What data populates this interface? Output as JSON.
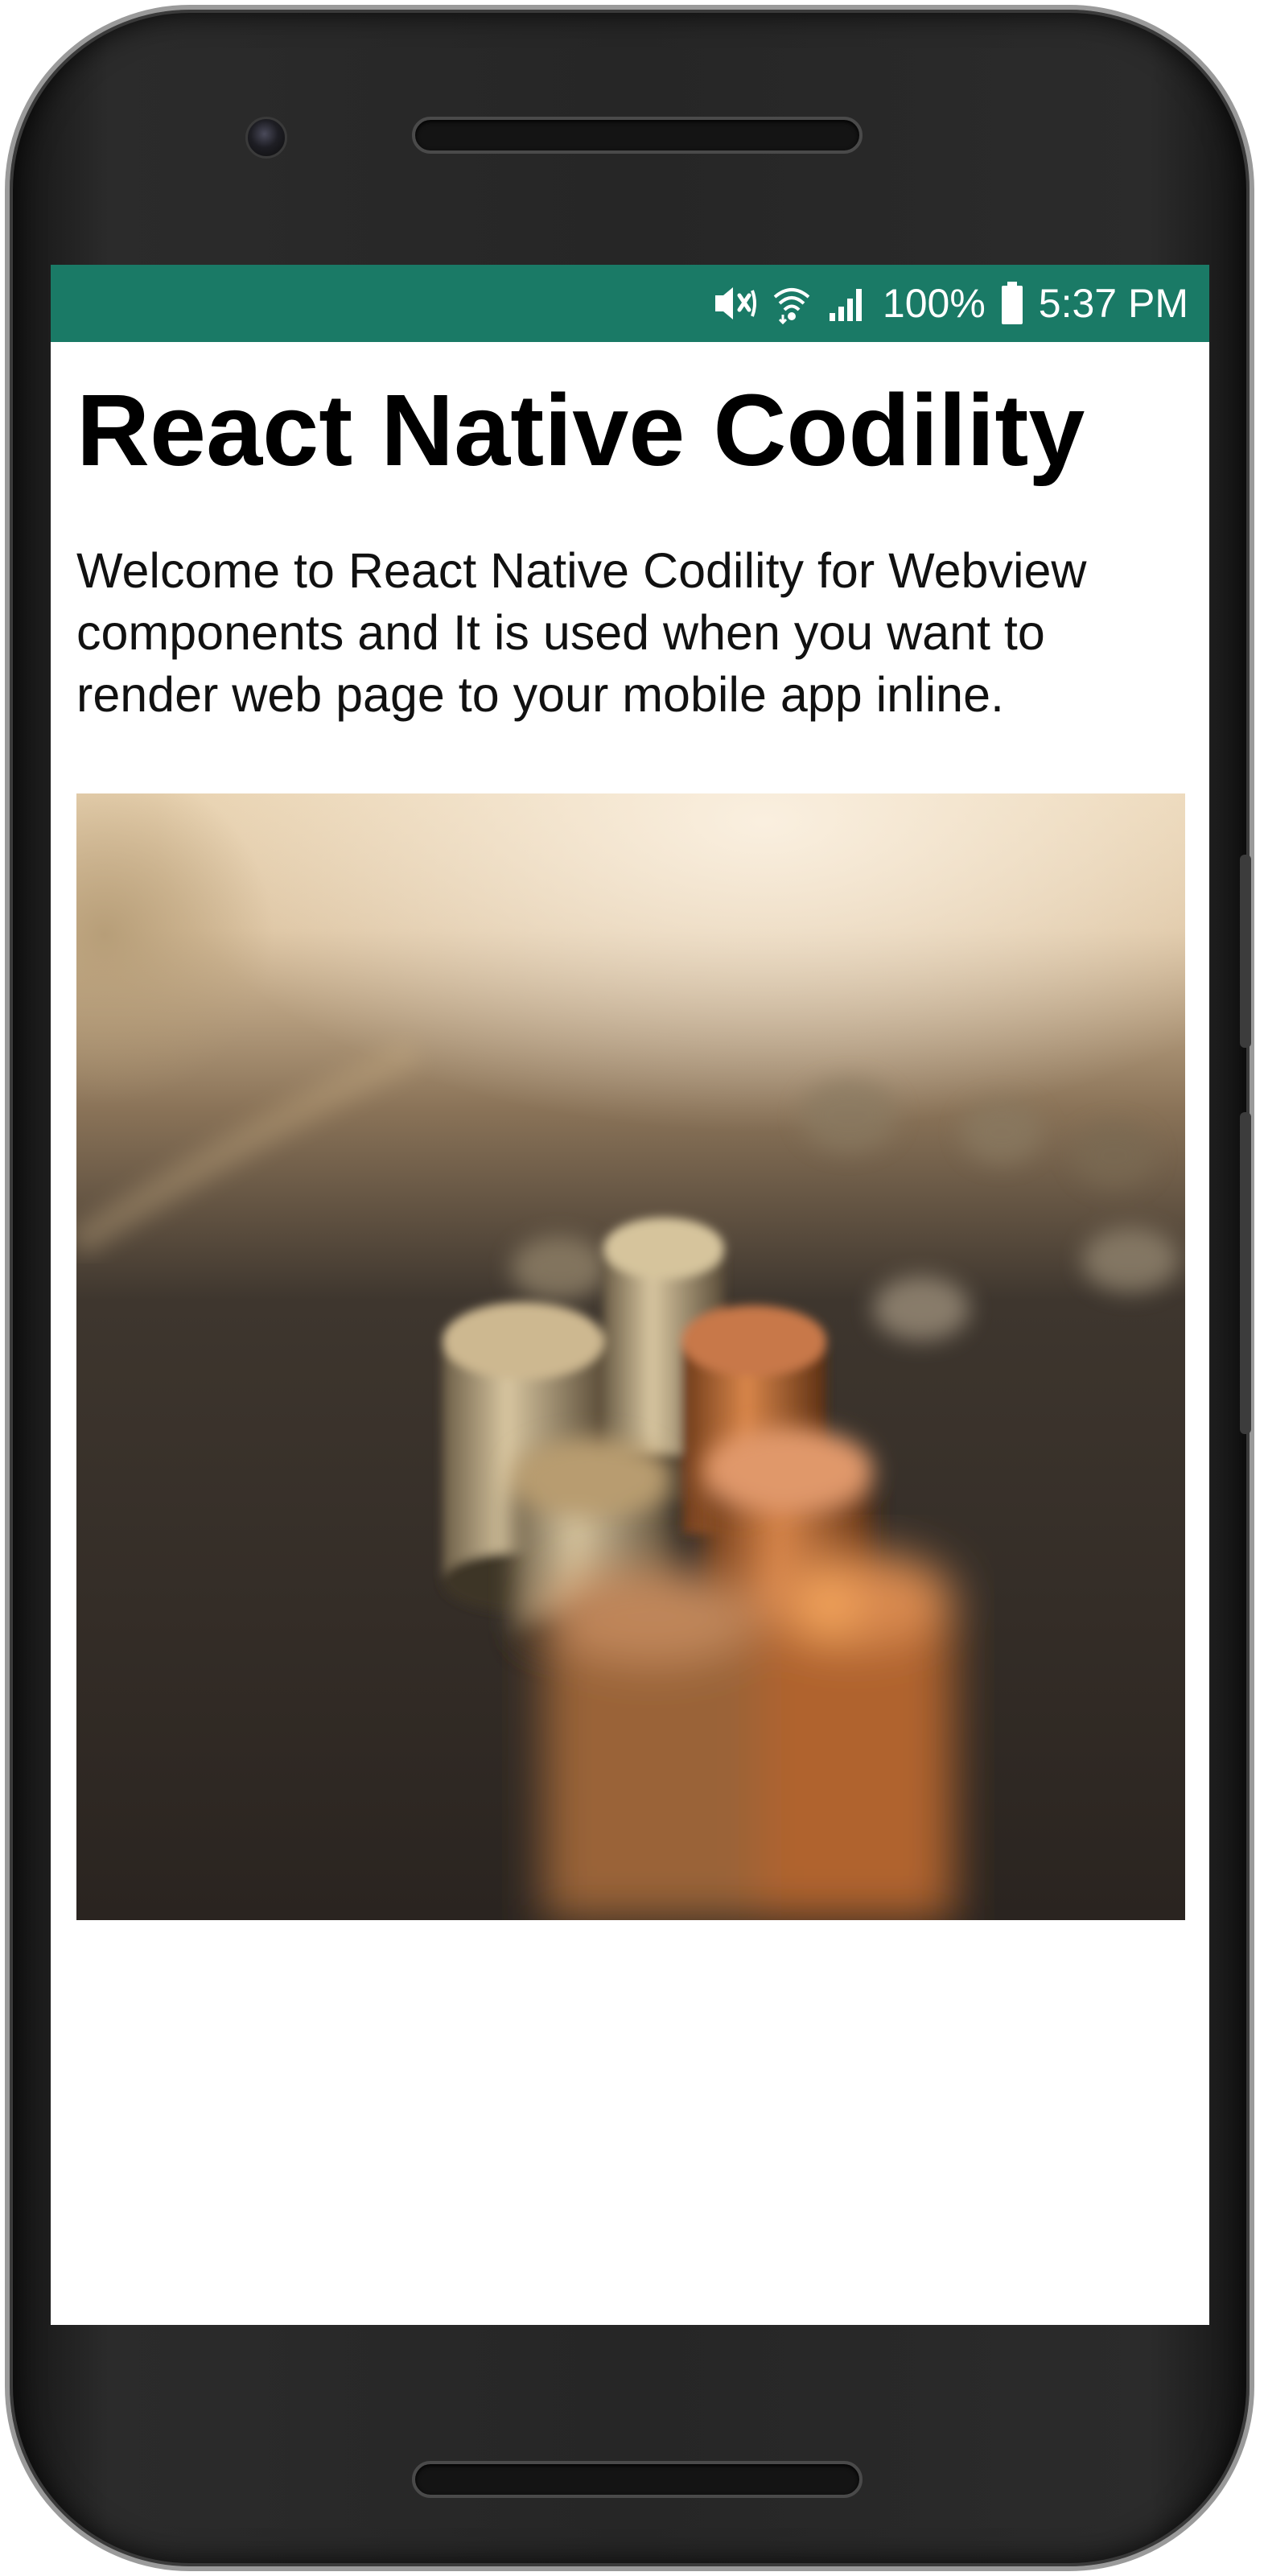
{
  "status_bar": {
    "background": "#1a7a66",
    "icons": [
      "vibrate-mute-icon",
      "wifi-icon",
      "cell-signal-icon",
      "battery-icon"
    ],
    "battery_percent": "100%",
    "time": "5:37 PM"
  },
  "page": {
    "title": "React Native Codility",
    "intro": "Welcome to React Native Codility for Webview components and It is used when you want to render web page to your mobile app inline."
  },
  "photo": {
    "subject": "stacks of coins on a table"
  }
}
